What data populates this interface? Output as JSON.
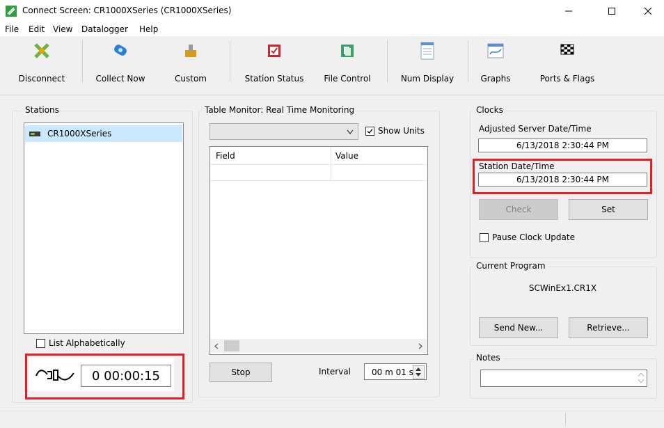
{
  "window": {
    "title": "Connect Screen: CR1000XSeries (CR1000XSeries)"
  },
  "menu": [
    "File",
    "Edit",
    "View",
    "Datalogger",
    "Help"
  ],
  "toolbar": {
    "disconnect": "Disconnect",
    "collect_now": "Collect Now",
    "custom": "Custom",
    "station_status": "Station Status",
    "file_control": "File Control",
    "num_display": "Num Display",
    "graphs": "Graphs",
    "ports_flags": "Ports & Flags"
  },
  "stations": {
    "label": "Stations",
    "items": [
      "CR1000XSeries"
    ],
    "list_alphabetically": "List Alphabetically",
    "connection_timer": "0 00:00:15"
  },
  "table_monitor": {
    "label": "Table Monitor: Real Time Monitoring",
    "show_units": "Show Units",
    "columns": [
      "Field",
      "Value"
    ],
    "stop": "Stop",
    "interval_label": "Interval",
    "interval_value": "00 m 01 s"
  },
  "clocks": {
    "label": "Clocks",
    "server_label": "Adjusted Server Date/Time",
    "server_value": "6/13/2018 2:30:44 PM",
    "station_label": "Station Date/Time",
    "station_value": "6/13/2018 2:30:44 PM",
    "check": "Check",
    "set": "Set",
    "pause": "Pause Clock Update"
  },
  "program": {
    "label": "Current Program",
    "name": "SCWinEx1.CR1X",
    "send_new": "Send New...",
    "retrieve": "Retrieve..."
  },
  "notes": {
    "label": "Notes"
  },
  "colors": {
    "highlight_red": "#e0212a",
    "selection": "#cce8ff"
  }
}
